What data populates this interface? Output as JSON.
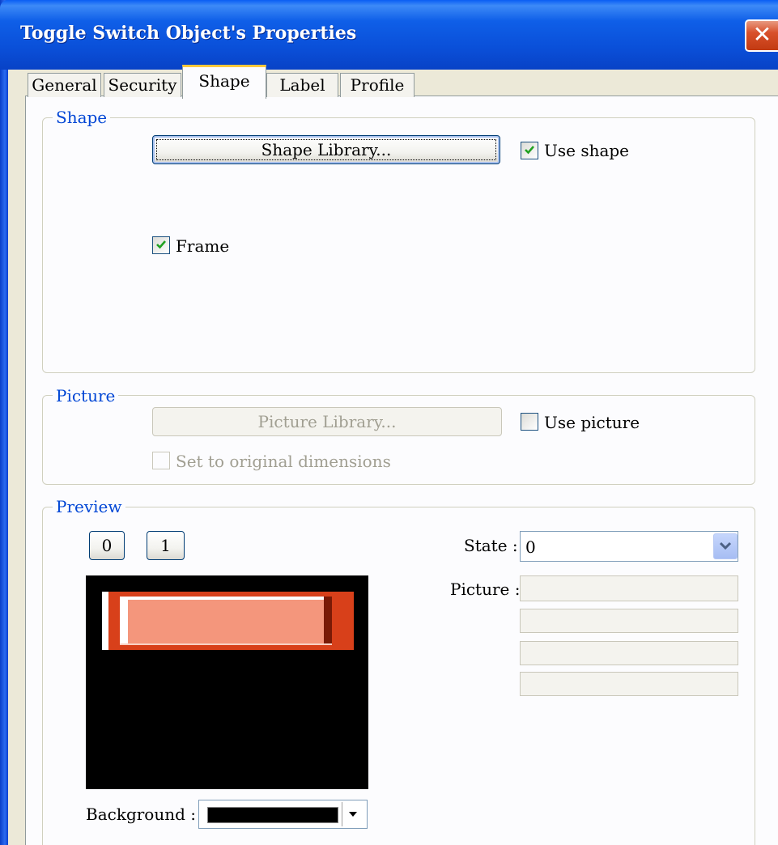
{
  "window": {
    "title": "Toggle Switch Object's Properties",
    "close_glyph": "✕"
  },
  "tabs": [
    {
      "label": "General",
      "active": false
    },
    {
      "label": "Security",
      "active": false
    },
    {
      "label": "Shape",
      "active": true
    },
    {
      "label": "Label",
      "active": false
    },
    {
      "label": "Profile",
      "active": false
    }
  ],
  "shape_group": {
    "legend": "Shape",
    "library_button": "Shape Library...",
    "use_shape": {
      "label": "Use shape",
      "checked": true
    },
    "frame": {
      "label": "Frame",
      "checked": true
    }
  },
  "picture_group": {
    "legend": "Picture",
    "library_button": "Picture Library...",
    "use_picture": {
      "label": "Use picture",
      "checked": false
    },
    "set_original": {
      "label": "Set to original dimensions",
      "checked": false,
      "disabled": true
    }
  },
  "preview_group": {
    "legend": "Preview",
    "state_buttons": [
      "0",
      "1"
    ],
    "state_label": "State :",
    "state_value": "0",
    "picture_label": "Picture :",
    "picture_fields": [
      "",
      "",
      "",
      ""
    ],
    "background_label": "Background :",
    "background_color": "#000000",
    "shape_fill_color": "#f4967c",
    "shape_border_color": "#d8401a"
  },
  "icons": {
    "check": "check-icon",
    "dropdown": "chevron-down-icon",
    "close": "close-icon"
  }
}
